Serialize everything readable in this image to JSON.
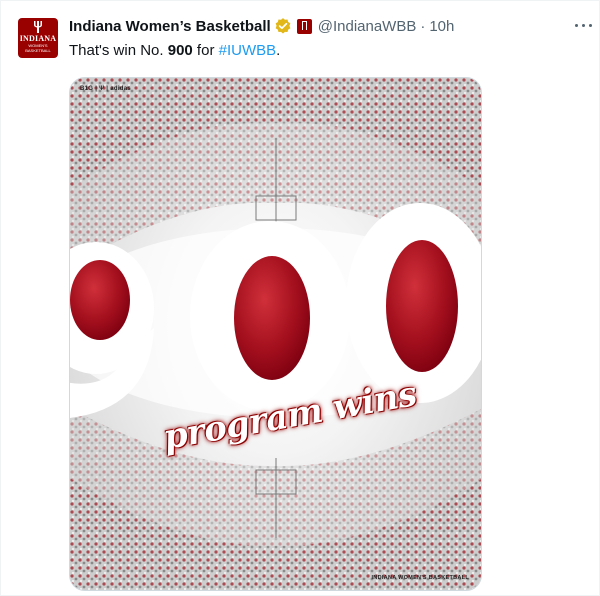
{
  "tweet": {
    "account_name": "Indiana Women’s Basketball",
    "handle": "@IndianaWBB",
    "separator": "·",
    "time": "10h",
    "text_before": "That's win No. ",
    "text_bold": "900",
    "text_mid": " for ",
    "hashtag": "#IUWBB",
    "text_after": ".",
    "avatar_line1": "INDIANA",
    "avatar_line2": "WOMEN'S BASKETBALL"
  },
  "media": {
    "number_graphic": "900",
    "script_text": "program wins",
    "brand_top": "B1G | Ψ | adidas",
    "brand_bottom": "INDIANA WOMEN'S BASKETBALL"
  },
  "colors": {
    "brand_crimson": "#990000",
    "hashtag_blue": "#1d9bf0",
    "verified_gold": "#e2b719",
    "muted_text": "#536471"
  },
  "icons": [
    "verified-badge-icon",
    "indiana-mini-logo-icon",
    "more-options-icon",
    "trident-icon"
  ]
}
